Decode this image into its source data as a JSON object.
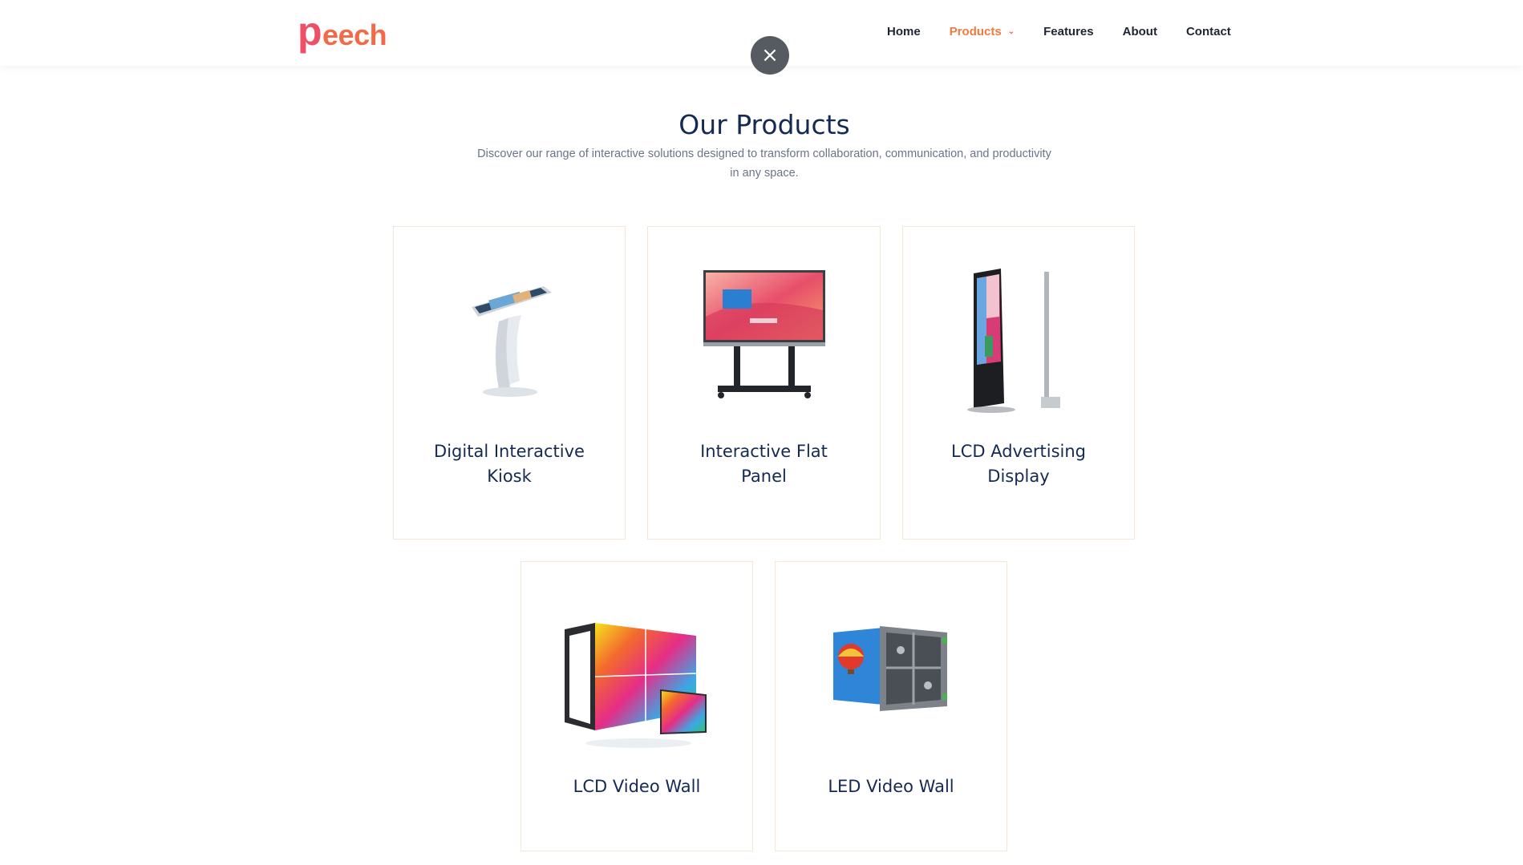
{
  "header": {
    "logo_initial": "p",
    "logo_rest": "eech",
    "nav": {
      "home": "Home",
      "products": "Products",
      "features": "Features",
      "about": "About",
      "contact": "Contact"
    }
  },
  "overlay": {
    "close_glyph": "×"
  },
  "section": {
    "title": "Our Products",
    "subtitle": "Discover our range of interactive solutions designed to transform collaboration, communication, and productivity in any space."
  },
  "products": [
    {
      "name": "Digital Interactive Kiosk",
      "icon": "kiosk-image"
    },
    {
      "name": "Interactive Flat Panel",
      "icon": "flat-panel-image"
    },
    {
      "name": "LCD Advertising Display",
      "icon": "advertising-display-image"
    },
    {
      "name": "LCD Video Wall",
      "icon": "lcd-video-wall-image"
    },
    {
      "name": "LED Video Wall",
      "icon": "led-video-wall-image"
    }
  ],
  "colors": {
    "accent": "#f27a3c",
    "logo": "#f36a48",
    "heading": "#142a52",
    "card_border": "#f6e6d6",
    "close_button": "#555b60"
  }
}
